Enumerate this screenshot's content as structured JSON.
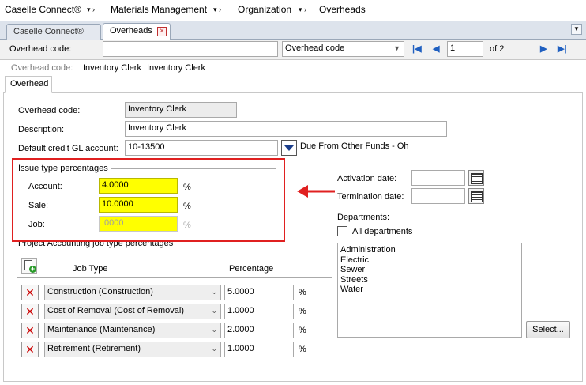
{
  "breadcrumb": {
    "app": "Caselle Connect®",
    "module": "Materials Management",
    "section": "Organization",
    "page": "Overheads"
  },
  "tabs": {
    "first": "Caselle Connect®",
    "second": "Overheads"
  },
  "toolbar": {
    "code_label": "Overhead code:",
    "code_value": "",
    "sort_select": "Overhead code",
    "page_value": "1",
    "page_total": "of 2"
  },
  "subheader": {
    "label": "Overhead code:",
    "code": "Inventory Clerk",
    "description": "Inventory Clerk"
  },
  "inner_tab": "Overhead",
  "form": {
    "code_label": "Overhead code:",
    "code_value": "Inventory Clerk",
    "description_label": "Description:",
    "description_value": "Inventory Clerk",
    "gl_label": "Default credit GL account:",
    "gl_value": "10-13500",
    "gl_desc": "Due From Other Funds - Oh"
  },
  "issue": {
    "title": "Issue type percentages",
    "account_label": "Account:",
    "account_value": "4.0000",
    "sale_label": "Sale:",
    "sale_value": "10.0000",
    "job_label": "Job:",
    "job_value": ".0000",
    "pct": "%"
  },
  "project": {
    "title": "Project Accounting job type percentages",
    "col_job_type": "Job Type",
    "col_percentage": "Percentage",
    "rows": [
      {
        "job_type": "Construction (Construction)",
        "percentage": "5.0000",
        "pct": "%"
      },
      {
        "job_type": "Cost of Removal (Cost of Removal)",
        "percentage": "1.0000",
        "pct": "%"
      },
      {
        "job_type": "Maintenance (Maintenance)",
        "percentage": "2.0000",
        "pct": "%"
      },
      {
        "job_type": "Retirement (Retirement)",
        "percentage": "1.0000",
        "pct": "%"
      }
    ]
  },
  "dates": {
    "activation_label": "Activation date:",
    "activation_value": "",
    "termination_label": "Termination date:",
    "termination_value": ""
  },
  "departments": {
    "label": "Departments:",
    "all_label": "All departments",
    "items": [
      "Administration",
      "Electric",
      "Sewer",
      "Streets",
      "Water"
    ],
    "select_button": "Select..."
  },
  "colors": {
    "highlight": "#ffff00",
    "callout": "#e02020",
    "nav_blue": "#1f5fc0"
  }
}
